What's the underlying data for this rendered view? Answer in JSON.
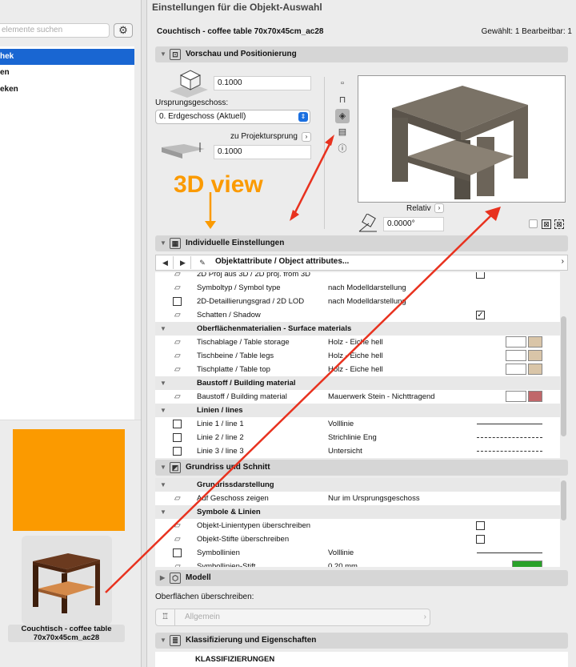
{
  "window": {
    "title": "Einstellungen für die Objekt-Auswahl"
  },
  "left": {
    "search_placeholder": "elemente suchen",
    "gear": "⚙",
    "tree_items": [
      "hek",
      "en",
      "eken"
    ],
    "thumb_caption": "Couchtisch - coffee table 70x70x45cm_ac28"
  },
  "header": {
    "object_name": "Couchtisch - coffee table 70x70x45cm_ac28",
    "selection": "Gewählt: 1 Bearbeitbar: 1"
  },
  "sections": {
    "preview": "Vorschau und Positionierung",
    "individual": "Individuelle Einstellungen",
    "floorplan": "Grundriss und Schnitt",
    "model": "Modell",
    "classification": "Klassifizierung und Eigenschaften"
  },
  "positioning": {
    "height_value": "0.1000",
    "origin_label": "Ursprungsgeschoss:",
    "origin_value": "0. Erdgeschoss (Aktuell)",
    "to_project_origin": "zu Projektursprung",
    "offset_value": "0.1000",
    "relative": "Relativ",
    "angle_value": "0.0000°"
  },
  "annotation": {
    "text": "3D view"
  },
  "navbar": {
    "title": "Objektattribute / Object attributes..."
  },
  "attr_rows": [
    {
      "type": "item",
      "name": "2D Proj aus 3D / 2D proj. from 3D",
      "value": "",
      "checkbox": true,
      "checked": false
    },
    {
      "type": "item",
      "name": "Symboltyp / Symbol type",
      "value": "nach Modelldarstellung"
    },
    {
      "type": "item",
      "name": "2D-Detaillierungsgrad / 2D LOD",
      "value": "nach Modelldarstellung",
      "lcheck": true
    },
    {
      "type": "item",
      "name": "Schatten / Shadow",
      "value": "",
      "checkbox": true,
      "checked": true
    },
    {
      "type": "group",
      "name": "Oberflächenmaterialien - Surface materials"
    },
    {
      "type": "item",
      "name": "Tischablage / Table storage",
      "value": "Holz - Eiche hell",
      "swatch": "#d9c5a8"
    },
    {
      "type": "item",
      "name": "Tischbeine / Table legs",
      "value": "Holz - Eiche hell",
      "swatch": "#d9c5a8"
    },
    {
      "type": "item",
      "name": "Tischplatte / Table top",
      "value": "Holz - Eiche hell",
      "swatch": "#d9c5a8"
    },
    {
      "type": "group",
      "name": "Baustoff / Building material"
    },
    {
      "type": "item",
      "name": "Baustoff / Building material",
      "value": "Mauerwerk Stein - Nichttragend",
      "swatch": "#c0676a"
    },
    {
      "type": "group",
      "name": "Linien / lines"
    },
    {
      "type": "item",
      "name": "Linie 1 / line 1",
      "value": "Volllinie",
      "line": "solid"
    },
    {
      "type": "item",
      "name": "Linie 2 / line 2",
      "value": "Strichlinie Eng",
      "line": "dashed"
    },
    {
      "type": "item",
      "name": "Linie 3 / line 3",
      "value": "Untersicht",
      "line": "dashed"
    }
  ],
  "floor_rows": [
    {
      "type": "group",
      "name": "Grundrissdarstellung"
    },
    {
      "type": "item",
      "name": "Auf Geschoss zeigen",
      "value": "Nur im Ursprungsgeschoss"
    },
    {
      "type": "group",
      "name": "Symbole & Linien"
    },
    {
      "type": "item",
      "name": "Objekt-Linientypen überschreiben",
      "value": "",
      "checkbox": true
    },
    {
      "type": "item",
      "name": "Objekt-Stifte überschreiben",
      "value": "",
      "checkbox": true
    },
    {
      "type": "item",
      "name": "Symbollinien",
      "value": "Volllinie",
      "line": "solid"
    },
    {
      "type": "item",
      "name": "Symbollinien-Stift",
      "value": "0.20 mm",
      "pen": "4"
    }
  ],
  "model": {
    "override_label": "Oberflächen überschreiben:",
    "override_value": "Allgemein"
  },
  "classification": {
    "header": "KLASSIFIZIERUNGEN"
  },
  "colors": {
    "accent": "#1966d2",
    "annotation": "#fb9a00",
    "arrow": "#e8321f"
  }
}
